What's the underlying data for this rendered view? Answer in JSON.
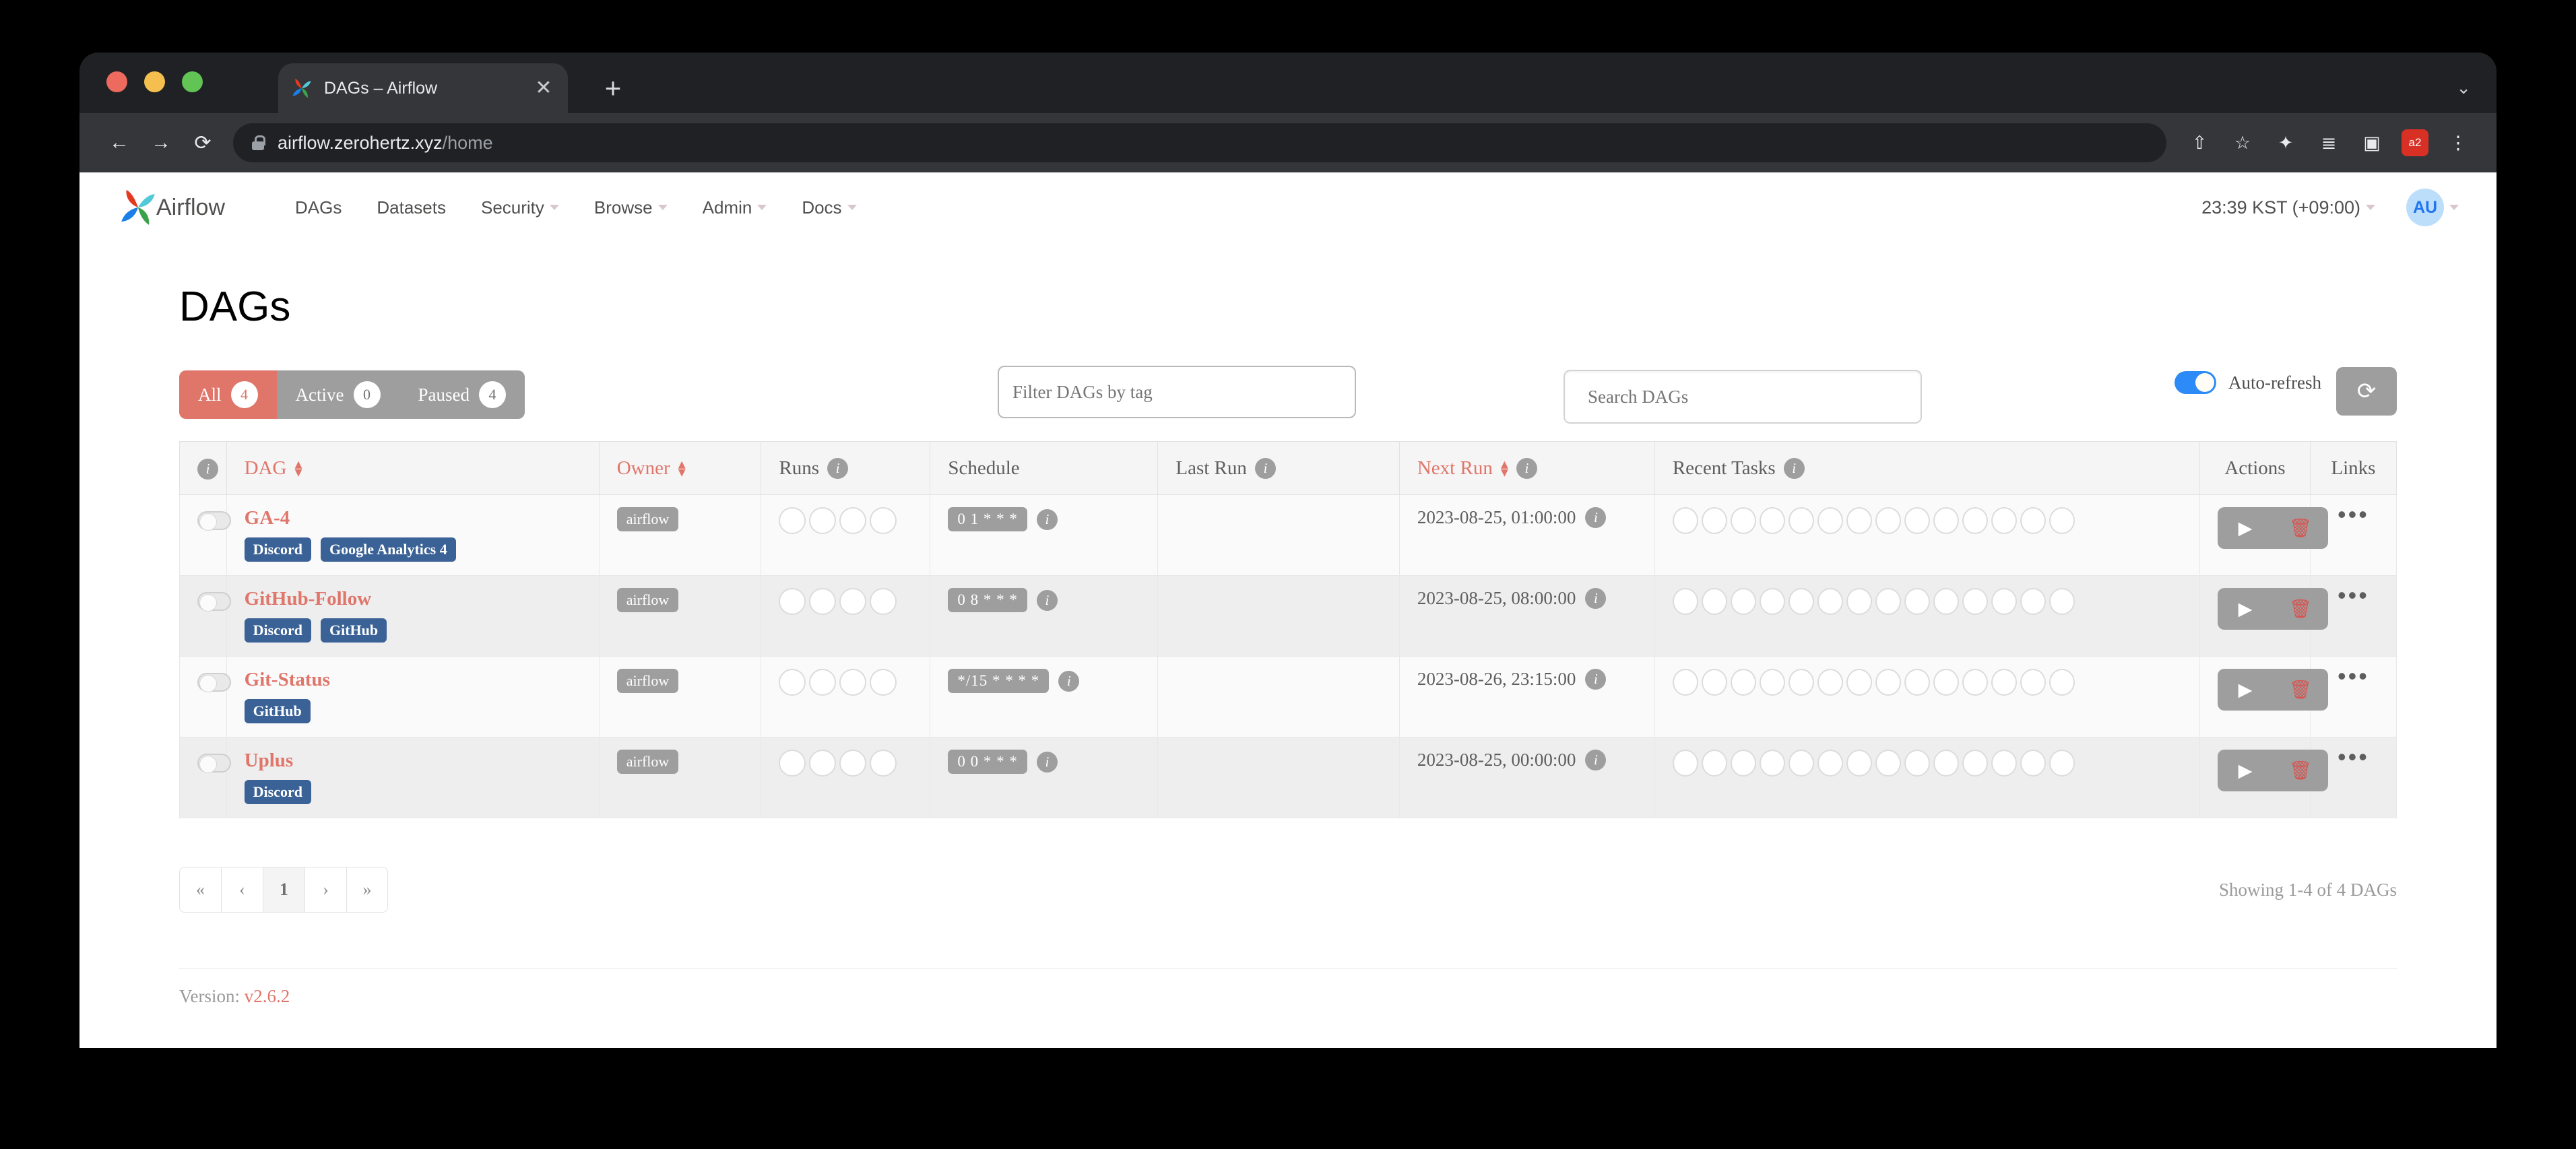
{
  "browser": {
    "tab_title": "DAGs – Airflow",
    "tab_favicon": "airflow-pinwheel-icon",
    "close_label": "✕",
    "new_tab_label": "+",
    "window_chevron": "⌄",
    "back_label": "←",
    "forward_label": "→",
    "reload_label": "⟳",
    "url_domain": "airflow.zerohertz.xyz",
    "url_path": "/home",
    "share_label": "⇧",
    "bookmark_label": "☆",
    "extensions_label": "✦",
    "list_label": "≣",
    "sidepanel_label": "▣",
    "ext_badge_label": "a2",
    "menu_label": "⋮"
  },
  "navbar": {
    "brand": "Airflow",
    "items": [
      {
        "label": "DAGs",
        "has_caret": false
      },
      {
        "label": "Datasets",
        "has_caret": false
      },
      {
        "label": "Security",
        "has_caret": true
      },
      {
        "label": "Browse",
        "has_caret": true
      },
      {
        "label": "Admin",
        "has_caret": true
      },
      {
        "label": "Docs",
        "has_caret": true
      }
    ],
    "clock": "23:39 KST (+09:00)",
    "avatar_initials": "AU"
  },
  "page": {
    "title": "DAGs"
  },
  "filters": {
    "all_label": "All",
    "all_count": "4",
    "active_label": "Active",
    "active_count": "0",
    "paused_label": "Paused",
    "paused_count": "4",
    "tag_placeholder": "Filter DAGs by tag",
    "tag_value": "",
    "search_placeholder": "Search DAGs",
    "search_value": "",
    "autorefresh_label": "Auto-refresh",
    "autorefresh_on": true,
    "refresh_icon": "⟳"
  },
  "table": {
    "headers": {
      "toggle": "",
      "dag": "DAG",
      "owner": "Owner",
      "runs": "Runs",
      "schedule": "Schedule",
      "last_run": "Last Run",
      "next_run": "Next Run",
      "recent_tasks": "Recent Tasks",
      "actions": "Actions",
      "links": "Links"
    },
    "runs_circle_count": 4,
    "tasks_circle_count": 14,
    "rows": [
      {
        "name": "GA-4",
        "tags": [
          "Discord",
          "Google Analytics 4"
        ],
        "owner": "airflow",
        "schedule": "0 1 * * *",
        "last_run": "",
        "next_run": "2023-08-25, 01:00:00",
        "paused": true,
        "trigger_icon": "▶",
        "delete_icon": "🗑",
        "links_icon": "•••"
      },
      {
        "name": "GitHub-Follow",
        "tags": [
          "Discord",
          "GitHub"
        ],
        "owner": "airflow",
        "schedule": "0 8 * * *",
        "last_run": "",
        "next_run": "2023-08-25, 08:00:00",
        "paused": true,
        "trigger_icon": "▶",
        "delete_icon": "🗑",
        "links_icon": "•••"
      },
      {
        "name": "Git-Status",
        "tags": [
          "GitHub"
        ],
        "owner": "airflow",
        "schedule": "*/15 * * * *",
        "last_run": "",
        "next_run": "2023-08-26, 23:15:00",
        "paused": true,
        "trigger_icon": "▶",
        "delete_icon": "🗑",
        "links_icon": "•••"
      },
      {
        "name": "Uplus",
        "tags": [
          "Discord"
        ],
        "owner": "airflow",
        "schedule": "0 0 * * *",
        "last_run": "",
        "next_run": "2023-08-25, 00:00:00",
        "paused": true,
        "trigger_icon": "▶",
        "delete_icon": "🗑",
        "links_icon": "•••"
      }
    ]
  },
  "pagination": {
    "first": "«",
    "prev": "‹",
    "current": "1",
    "next": "›",
    "last": "»",
    "showing": "Showing 1-4 of 4 DAGs"
  },
  "footer": {
    "version_label": "Version:",
    "version_value": "v2.6.2"
  },
  "colors": {
    "accent": "#e0756a",
    "tag_blue": "#3a6296",
    "gray": "#9e9e9e",
    "toggle_blue": "#2c8bf7"
  }
}
